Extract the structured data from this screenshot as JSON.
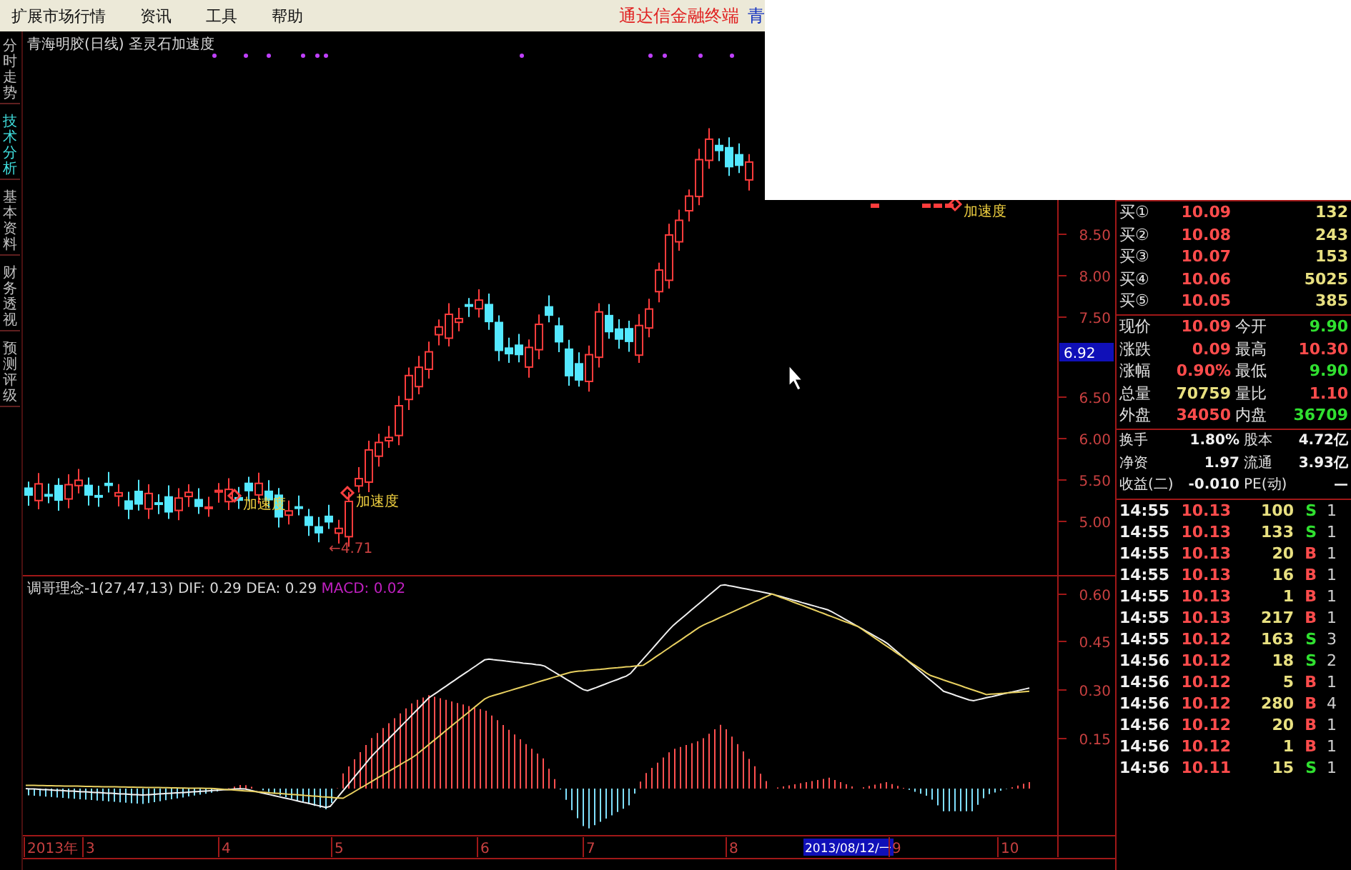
{
  "menu": {
    "items": [
      "扩展市场行情",
      "资讯",
      "工具",
      "帮助"
    ],
    "brand": "通达信金融终端",
    "brand_cut": "青"
  },
  "side_tabs": [
    {
      "label": "分时走势",
      "selected": false
    },
    {
      "label": "技术分析",
      "selected": true
    },
    {
      "label": "基本资料",
      "selected": false
    },
    {
      "label": "财务透视",
      "selected": false
    },
    {
      "label": "预测评级",
      "selected": false
    }
  ],
  "price_chart": {
    "title": "青海明胶(日线) 圣灵石加速度",
    "axis": [
      "8.50",
      "8.00",
      "7.50",
      "6.50",
      "6.00",
      "5.50",
      "5.00"
    ],
    "cursor_value": "6.92",
    "annotations": [
      "加速度",
      "加速度",
      "加速度"
    ],
    "low_marker": "←4.71"
  },
  "indicator": {
    "title": "调哥理念-1(27,47,13)",
    "dif": "DIF: 0.29",
    "dea": "DEA: 0.29",
    "macd": "MACD: 0.02",
    "axis": [
      "0.60",
      "0.45",
      "0.30",
      "0.15"
    ]
  },
  "date_axis": [
    {
      "label": "2013年",
      "kind": "year"
    },
    {
      "label": "3",
      "kind": "month"
    },
    {
      "label": "4",
      "kind": "month"
    },
    {
      "label": "5",
      "kind": "month"
    },
    {
      "label": "6",
      "kind": "month"
    },
    {
      "label": "7",
      "kind": "month"
    },
    {
      "label": "8",
      "kind": "month"
    },
    {
      "label": "2013/08/12/一",
      "kind": "cursor"
    },
    {
      "label": "9",
      "kind": "month"
    },
    {
      "label": "10",
      "kind": "month"
    }
  ],
  "quote": {
    "bids": [
      {
        "label": "买①",
        "price": "10.09",
        "volume": "132"
      },
      {
        "label": "买②",
        "price": "10.08",
        "volume": "243"
      },
      {
        "label": "买③",
        "price": "10.07",
        "volume": "153"
      },
      {
        "label": "买④",
        "price": "10.06",
        "volume": "5025"
      },
      {
        "label": "买⑤",
        "price": "10.05",
        "volume": "385"
      }
    ],
    "stats": [
      [
        {
          "label": "现价",
          "value": "10.09",
          "color": "#ff4c4c"
        },
        {
          "label": "今开",
          "value": "9.90",
          "color": "#30e030"
        }
      ],
      [
        {
          "label": "涨跌",
          "value": "0.09",
          "color": "#ff4c4c"
        },
        {
          "label": "最高",
          "value": "10.30",
          "color": "#ff4c4c"
        }
      ],
      [
        {
          "label": "涨幅",
          "value": "0.90%",
          "color": "#ff4c4c"
        },
        {
          "label": "最低",
          "value": "9.90",
          "color": "#30e030"
        }
      ],
      [
        {
          "label": "总量",
          "value": "70759",
          "color": "#e8e080"
        },
        {
          "label": "量比",
          "value": "1.10",
          "color": "#ff4c4c"
        }
      ],
      [
        {
          "label": "外盘",
          "value": "34050",
          "color": "#ff4c4c"
        },
        {
          "label": "内盘",
          "value": "36709",
          "color": "#30e030"
        }
      ]
    ],
    "fundamentals": [
      [
        {
          "label": "换手",
          "value": "1.80%"
        },
        {
          "label": "股本",
          "value": "4.72亿"
        }
      ],
      [
        {
          "label": "净资",
          "value": "1.97"
        },
        {
          "label": "流通",
          "value": "3.93亿"
        }
      ],
      [
        {
          "label": "收益(二)",
          "value": "-0.010"
        },
        {
          "label": "PE(动)",
          "value": "—"
        }
      ]
    ]
  },
  "trades": [
    {
      "time": "14:55",
      "price": "10.13",
      "volume": "100",
      "side": "S",
      "kind": "sell",
      "count": "1"
    },
    {
      "time": "14:55",
      "price": "10.13",
      "volume": "133",
      "side": "S",
      "kind": "sell",
      "count": "1"
    },
    {
      "time": "14:55",
      "price": "10.13",
      "volume": "20",
      "side": "B",
      "kind": "buy",
      "count": "1"
    },
    {
      "time": "14:55",
      "price": "10.13",
      "volume": "16",
      "side": "B",
      "kind": "buy",
      "count": "1"
    },
    {
      "time": "14:55",
      "price": "10.13",
      "volume": "1",
      "side": "B",
      "kind": "buy",
      "count": "1"
    },
    {
      "time": "14:55",
      "price": "10.13",
      "volume": "217",
      "side": "B",
      "kind": "buy",
      "count": "1"
    },
    {
      "time": "14:55",
      "price": "10.12",
      "volume": "163",
      "side": "S",
      "kind": "sell",
      "count": "3"
    },
    {
      "time": "14:56",
      "price": "10.12",
      "volume": "18",
      "side": "S",
      "kind": "sell",
      "count": "2"
    },
    {
      "time": "14:56",
      "price": "10.12",
      "volume": "5",
      "side": "B",
      "kind": "buy",
      "count": "1"
    },
    {
      "time": "14:56",
      "price": "10.12",
      "volume": "280",
      "side": "B",
      "kind": "buy",
      "count": "4"
    },
    {
      "time": "14:56",
      "price": "10.12",
      "volume": "20",
      "side": "B",
      "kind": "buy",
      "count": "1"
    },
    {
      "time": "14:56",
      "price": "10.12",
      "volume": "1",
      "side": "B",
      "kind": "buy",
      "count": "1"
    },
    {
      "time": "14:56",
      "price": "10.11",
      "volume": "15",
      "side": "S",
      "kind": "sell",
      "count": "1"
    }
  ]
}
